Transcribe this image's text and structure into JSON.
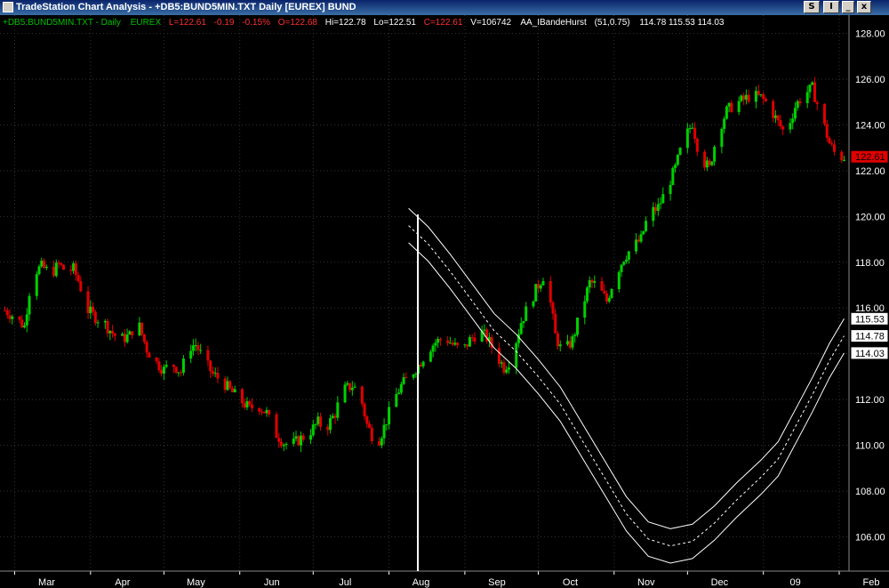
{
  "window": {
    "title": "TradeStation Chart Analysis  - +DB5:BUND5MIN.TXT  Daily  [EUREX] BUND",
    "btn_style": "S",
    "btn_indicator": "I",
    "btn_minimize": "_",
    "btn_close": "x"
  },
  "status_bar": {
    "symbol": "+DB5:BUND5MIN.TXT - Daily",
    "exchange": "EUREX",
    "last": "L=122.61",
    "change": "-0.19",
    "change_pct": "-0.15%",
    "open": "O=122.68",
    "high": "Hi=122.78",
    "low": "Lo=122.51",
    "close": "C=122.61",
    "volume": "V=106742",
    "indicator": "AA_IBandeHurst",
    "indicator_params": "(51,0.75)",
    "indicator_values": "114.78  115.53  114.03"
  },
  "colors": {
    "up": "#00d000",
    "down": "#e00000",
    "text_green": "#00c000",
    "text_red": "#ff3030",
    "text_white": "#ffffff",
    "grid": "#333333",
    "band": "#ffffff",
    "last_price_marker": "#e00000"
  },
  "chart_data": {
    "type": "candlestick",
    "x_labels": [
      "Mar",
      "Apr",
      "May",
      "Jun",
      "Jul",
      "Aug",
      "Sep",
      "Oct",
      "Nov",
      "Dec",
      "09",
      "Feb"
    ],
    "ylim": [
      104.5,
      128.8
    ],
    "y_ticks": [
      "128.00",
      "126.00",
      "124.00",
      "122.00",
      "120.00",
      "118.00",
      "116.00",
      "114.00",
      "112.00",
      "110.00",
      "108.00",
      "106.00"
    ],
    "grid": true,
    "price_series": [
      [
        "2008-02-26",
        115.9
      ],
      [
        "2008-03-01",
        115.6
      ],
      [
        "2008-03-05",
        115.2
      ],
      [
        "2008-03-08",
        117.5
      ],
      [
        "2008-03-12",
        117.8
      ],
      [
        "2008-03-16",
        117.5
      ],
      [
        "2008-03-19",
        117.9
      ],
      [
        "2008-03-22",
        117.6
      ],
      [
        "2008-03-25",
        117.7
      ],
      [
        "2008-03-27",
        117.2
      ],
      [
        "2008-03-31",
        115.9
      ],
      [
        "2008-04-03",
        115.6
      ],
      [
        "2008-04-07",
        115.3
      ],
      [
        "2008-04-10",
        114.9
      ],
      [
        "2008-04-13",
        114.6
      ],
      [
        "2008-04-17",
        114.8
      ],
      [
        "2008-04-20",
        115.5
      ],
      [
        "2008-04-24",
        114.2
      ],
      [
        "2008-04-27",
        113.7
      ],
      [
        "2008-05-01",
        113.3
      ],
      [
        "2008-05-04",
        113.6
      ],
      [
        "2008-05-08",
        113.2
      ],
      [
        "2008-05-11",
        114.3
      ],
      [
        "2008-05-14",
        114.4
      ],
      [
        "2008-05-18",
        113.6
      ],
      [
        "2008-05-21",
        113.1
      ],
      [
        "2008-05-25",
        112.8
      ],
      [
        "2008-05-28",
        112.4
      ],
      [
        "2008-06-01",
        112.0
      ],
      [
        "2008-06-05",
        111.6
      ],
      [
        "2008-06-08",
        111.8
      ],
      [
        "2008-06-12",
        111.4
      ],
      [
        "2008-06-15",
        110.6
      ],
      [
        "2008-06-19",
        110.1
      ],
      [
        "2008-06-22",
        110.0
      ],
      [
        "2008-06-26",
        110.3
      ],
      [
        "2008-06-29",
        110.5
      ],
      [
        "2008-07-03",
        111.0
      ],
      [
        "2008-07-06",
        110.7
      ],
      [
        "2008-07-10",
        111.4
      ],
      [
        "2008-07-13",
        112.4
      ],
      [
        "2008-07-17",
        112.6
      ],
      [
        "2008-07-20",
        112.3
      ],
      [
        "2008-07-23",
        110.9
      ],
      [
        "2008-07-27",
        110.0
      ],
      [
        "2008-07-30",
        110.8
      ],
      [
        "2008-08-03",
        112.0
      ],
      [
        "2008-08-06",
        112.6
      ],
      [
        "2008-08-10",
        113.1
      ],
      [
        "2008-08-13",
        113.5
      ],
      [
        "2008-08-17",
        114.2
      ],
      [
        "2008-08-20",
        114.5
      ],
      [
        "2008-08-24",
        114.7
      ],
      [
        "2008-08-27",
        114.4
      ],
      [
        "2008-08-31",
        114.1
      ],
      [
        "2008-09-03",
        114.6
      ],
      [
        "2008-09-07",
        115.0
      ],
      [
        "2008-09-10",
        114.7
      ],
      [
        "2008-09-13",
        114.1
      ],
      [
        "2008-09-17",
        113.4
      ],
      [
        "2008-09-20",
        113.8
      ],
      [
        "2008-09-24",
        115.4
      ],
      [
        "2008-09-27",
        116.1
      ],
      [
        "2008-10-01",
        117.0
      ],
      [
        "2008-10-04",
        117.6
      ],
      [
        "2008-10-08",
        114.8
      ],
      [
        "2008-10-11",
        114.0
      ],
      [
        "2008-10-15",
        114.6
      ],
      [
        "2008-10-18",
        115.7
      ],
      [
        "2008-10-22",
        117.1
      ],
      [
        "2008-10-25",
        117.0
      ],
      [
        "2008-10-29",
        116.3
      ],
      [
        "2008-11-01",
        117.3
      ],
      [
        "2008-11-05",
        118.2
      ],
      [
        "2008-11-08",
        118.6
      ],
      [
        "2008-11-12",
        119.0
      ],
      [
        "2008-11-15",
        120.1
      ],
      [
        "2008-11-19",
        120.4
      ],
      [
        "2008-11-22",
        121.1
      ],
      [
        "2008-11-26",
        122.1
      ],
      [
        "2008-11-29",
        123.2
      ],
      [
        "2008-12-03",
        124.1
      ],
      [
        "2008-12-06",
        122.6
      ],
      [
        "2008-12-10",
        122.1
      ],
      [
        "2008-12-13",
        123.6
      ],
      [
        "2008-12-17",
        124.6
      ],
      [
        "2008-12-20",
        124.9
      ],
      [
        "2008-12-24",
        125.1
      ],
      [
        "2008-12-27",
        125.3
      ],
      [
        "2008-12-31",
        125.2
      ],
      [
        "2009-01-03",
        124.9
      ],
      [
        "2009-01-07",
        124.1
      ],
      [
        "2009-01-10",
        123.6
      ],
      [
        "2009-01-14",
        124.8
      ],
      [
        "2009-01-17",
        125.3
      ],
      [
        "2009-01-21",
        125.6
      ],
      [
        "2009-01-24",
        124.6
      ],
      [
        "2009-01-28",
        123.2
      ],
      [
        "2009-01-31",
        122.6
      ],
      [
        "2009-02-03",
        122.6
      ]
    ],
    "band_series": {
      "name": "AA_IBandeHurst",
      "start_date": "2008-08-09",
      "mid": [
        [
          "2008-08-09",
          119.6
        ],
        [
          "2008-08-17",
          118.8
        ],
        [
          "2008-08-26",
          117.6
        ],
        [
          "2008-09-04",
          116.3
        ],
        [
          "2008-09-13",
          115.0
        ],
        [
          "2008-09-22",
          114.1
        ],
        [
          "2008-10-01",
          113.0
        ],
        [
          "2008-10-10",
          111.8
        ],
        [
          "2008-10-19",
          110.2
        ],
        [
          "2008-10-28",
          108.6
        ],
        [
          "2008-11-06",
          107.0
        ],
        [
          "2008-11-15",
          105.9
        ],
        [
          "2008-11-24",
          105.6
        ],
        [
          "2008-12-03",
          105.8
        ],
        [
          "2008-12-12",
          106.6
        ],
        [
          "2008-12-21",
          107.6
        ],
        [
          "2008-12-31",
          108.6
        ],
        [
          "2009-01-07",
          109.4
        ],
        [
          "2009-01-14",
          110.8
        ],
        [
          "2009-01-21",
          112.2
        ],
        [
          "2009-01-28",
          113.7
        ],
        [
          "2009-02-03",
          114.78
        ]
      ],
      "upper_offset": 0.75,
      "lower_offset": 0.75
    },
    "last_price_label": "122.61",
    "band_labels": [
      "115.53",
      "114.78",
      "114.03"
    ]
  }
}
